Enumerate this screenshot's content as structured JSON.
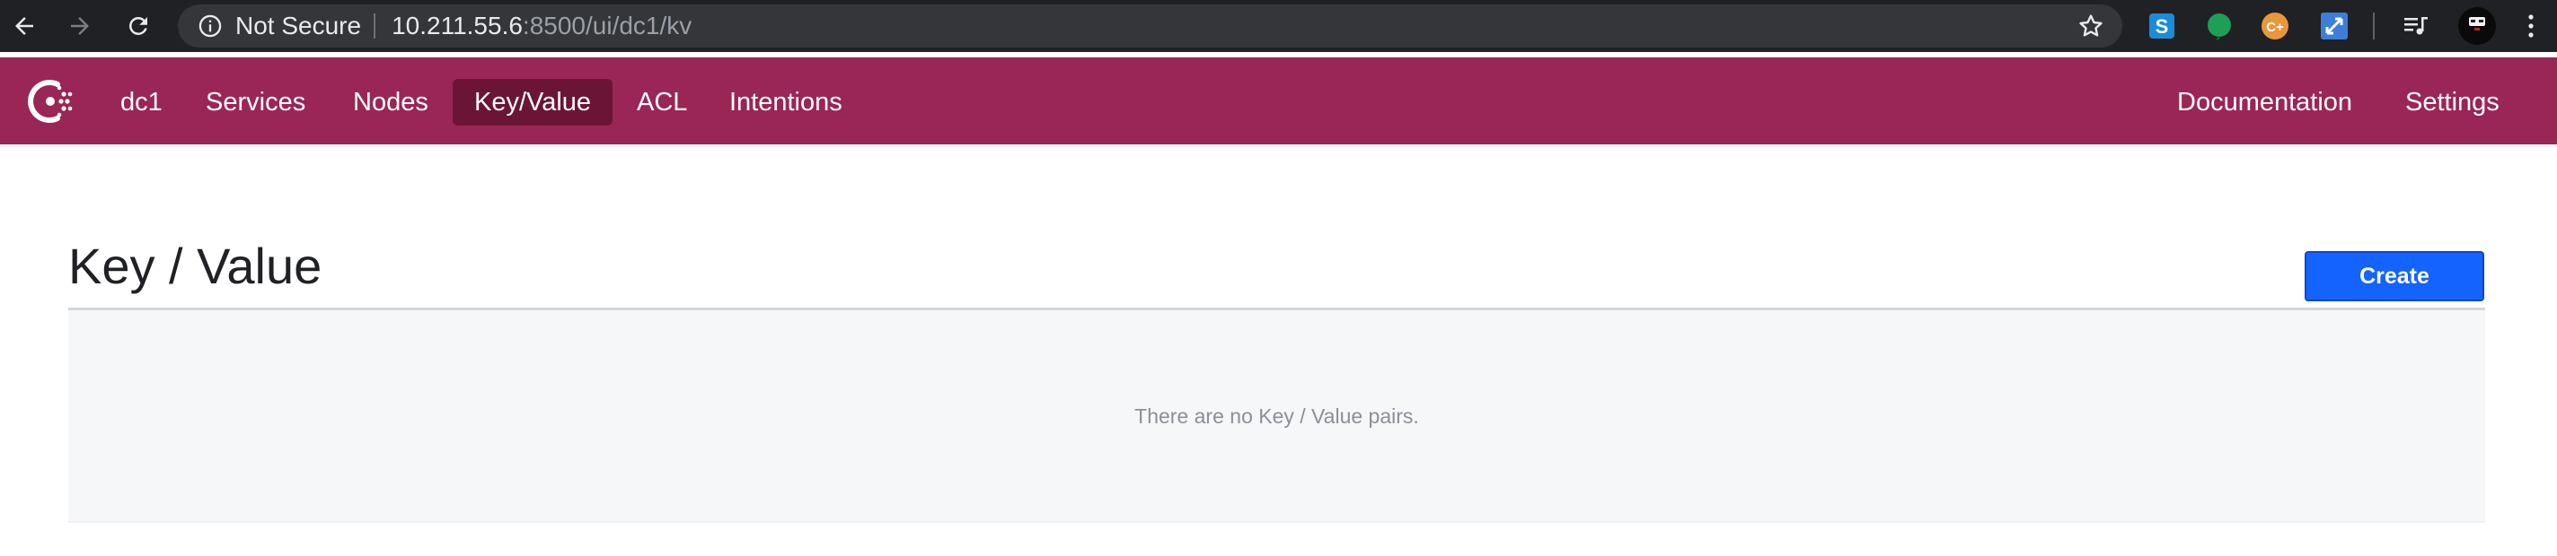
{
  "browser": {
    "security_label": "Not Secure",
    "url_host": "10.211.55.6",
    "url_path": ":8500/ui/dc1/kv",
    "icons": [
      "back-icon",
      "forward-icon",
      "reload-icon",
      "info-icon",
      "star-icon",
      "extension-s-icon",
      "extension-green-icon",
      "extension-c-icon",
      "extension-blue-icon",
      "media-icon",
      "avatar-icon",
      "menu-icon"
    ],
    "extension_c_label": "C+",
    "extension_s_label": "S"
  },
  "header": {
    "datacenter": "dc1",
    "nav": [
      {
        "label": "Services"
      },
      {
        "label": "Nodes"
      },
      {
        "label": "Key/Value",
        "active": true
      },
      {
        "label": "ACL"
      },
      {
        "label": "Intentions"
      }
    ],
    "right_nav": [
      {
        "label": "Documentation"
      },
      {
        "label": "Settings"
      }
    ]
  },
  "main": {
    "title": "Key / Value",
    "create_label": "Create",
    "empty_message": "There are no Key / Value pairs."
  },
  "colors": {
    "brand": "#9a2655",
    "brand_active": "#6b1536",
    "primary_button": "#1563ff",
    "chrome": "#202124",
    "omnibox": "#35363a"
  }
}
